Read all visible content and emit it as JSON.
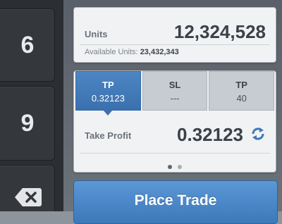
{
  "keypad": {
    "keys": [
      "6",
      "9"
    ],
    "backspace_icon": "backspace-icon"
  },
  "units": {
    "label": "Units",
    "value": "12,324,528",
    "available_label": "Available Units:",
    "available_value": "23,432,343"
  },
  "tabs": [
    {
      "title": "TP",
      "value": "0.32123",
      "active": true
    },
    {
      "title": "SL",
      "value": "---",
      "active": false
    },
    {
      "title": "TP",
      "value": "40",
      "active": false
    }
  ],
  "take_profit": {
    "label": "Take Profit",
    "value": "0.32123",
    "icon": "refresh-icon"
  },
  "pager": {
    "page_count": 2,
    "active_page": 1
  },
  "place_trade": {
    "label": "Place Trade"
  },
  "colors": {
    "accent": "#3d78b9",
    "panel": "#6c7279",
    "keypad": "#2b2e33"
  }
}
